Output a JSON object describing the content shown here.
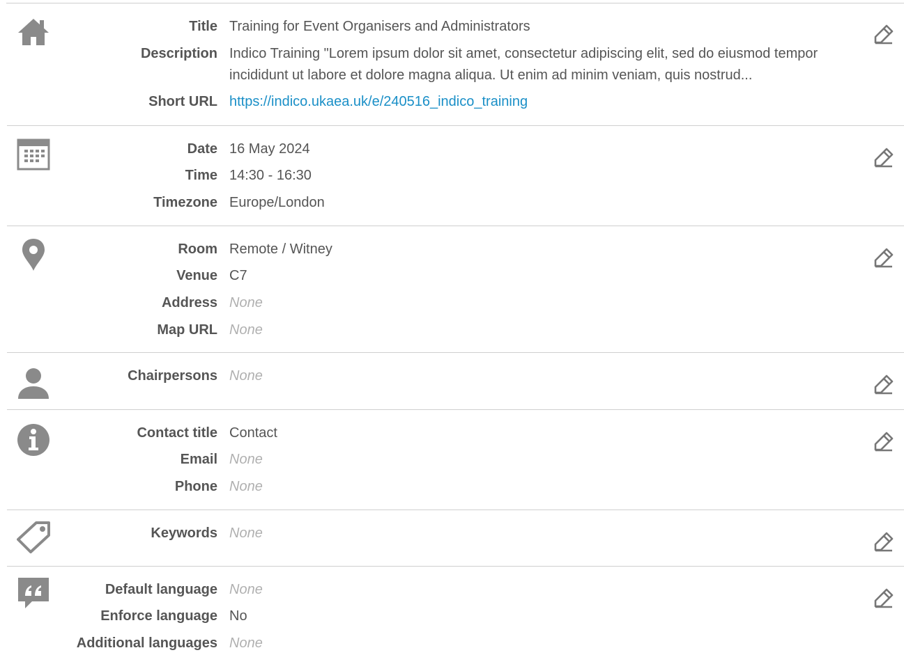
{
  "sections": {
    "title": {
      "title_label": "Title",
      "title_value": "Training for Event Organisers and Administrators",
      "description_label": "Description",
      "description_value": "Indico Training \"Lorem ipsum dolor sit amet, consectetur adipiscing elit, sed do eiusmod tempor incididunt ut labore et dolore magna aliqua. Ut enim ad minim veniam, quis nostrud...",
      "short_url_label": "Short URL",
      "short_url_value": "https://indico.ukaea.uk/e/240516_indico_training"
    },
    "datetime": {
      "date_label": "Date",
      "date_value": "16 May 2024",
      "time_label": "Time",
      "time_value": "14:30 - 16:30",
      "timezone_label": "Timezone",
      "timezone_value": "Europe/London"
    },
    "location": {
      "room_label": "Room",
      "room_value": "Remote / Witney",
      "venue_label": "Venue",
      "venue_value": "C7",
      "address_label": "Address",
      "address_value": "None",
      "map_url_label": "Map URL",
      "map_url_value": "None"
    },
    "chairpersons": {
      "chairpersons_label": "Chairpersons",
      "chairpersons_value": "None"
    },
    "contact": {
      "contact_title_label": "Contact title",
      "contact_title_value": "Contact",
      "email_label": "Email",
      "email_value": "None",
      "phone_label": "Phone",
      "phone_value": "None"
    },
    "keywords": {
      "keywords_label": "Keywords",
      "keywords_value": "None"
    },
    "language": {
      "default_language_label": "Default language",
      "default_language_value": "None",
      "enforce_language_label": "Enforce language",
      "enforce_language_value": "No",
      "additional_languages_label": "Additional languages",
      "additional_languages_value": "None"
    }
  },
  "icons": {
    "title": "home-icon",
    "datetime": "calendar-icon",
    "location": "map-pin-icon",
    "chairpersons": "user-icon",
    "contact": "info-icon",
    "keywords": "tag-icon",
    "language": "quote-icon",
    "edit": "pencil-icon"
  },
  "colors": {
    "text": "#555555",
    "muted": "#b0b0b0",
    "link": "#1a8fc7",
    "icon": "#8a8a8a",
    "border": "#cfcfcf"
  }
}
